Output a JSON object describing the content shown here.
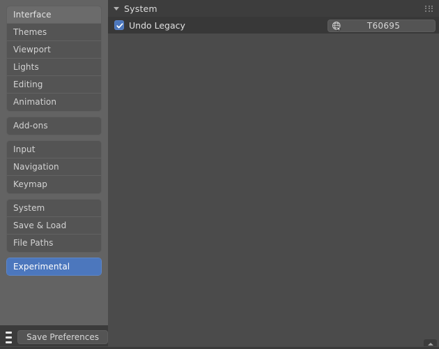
{
  "sidebar": {
    "groups": [
      {
        "name": "general",
        "items": [
          {
            "label": "Interface",
            "state": "hovered"
          },
          {
            "label": "Themes",
            "state": "normal"
          },
          {
            "label": "Viewport",
            "state": "normal"
          },
          {
            "label": "Lights",
            "state": "normal"
          },
          {
            "label": "Editing",
            "state": "normal"
          },
          {
            "label": "Animation",
            "state": "normal"
          }
        ]
      },
      {
        "name": "addons",
        "items": [
          {
            "label": "Add-ons",
            "state": "normal"
          }
        ]
      },
      {
        "name": "input",
        "items": [
          {
            "label": "Input",
            "state": "normal"
          },
          {
            "label": "Navigation",
            "state": "normal"
          },
          {
            "label": "Keymap",
            "state": "normal"
          }
        ]
      },
      {
        "name": "system",
        "items": [
          {
            "label": "System",
            "state": "normal"
          },
          {
            "label": "Save & Load",
            "state": "normal"
          },
          {
            "label": "File Paths",
            "state": "normal"
          }
        ]
      },
      {
        "name": "experimental",
        "items": [
          {
            "label": "Experimental",
            "state": "selected"
          }
        ]
      }
    ],
    "footer": {
      "menu_icon": "hamburger-menu-icon",
      "save_label": "Save Preferences"
    }
  },
  "main": {
    "header": {
      "disclosure_icon": "triangle-down-icon",
      "title": "System",
      "grip_icon": "drag-grip-icon"
    },
    "properties": [
      {
        "checkbox_checked": true,
        "label": "Undo Legacy",
        "link": {
          "icon": "globe-link-icon",
          "label": "T60695"
        }
      }
    ],
    "footer": {
      "scroll_up_icon": "chevron-up-icon"
    }
  },
  "colors": {
    "window_bg": "#3b3b3b",
    "sidebar_bg": "#636363",
    "main_bg": "#4b4b4b",
    "header_bg": "#3d3d3d",
    "row_bg": "#383838",
    "item_bg": "#545454",
    "item_hover_bg": "#6b6b6b",
    "accent_blue": "#4c77bd",
    "text": "#d3d3d3",
    "text_bright": "#ffffff"
  }
}
